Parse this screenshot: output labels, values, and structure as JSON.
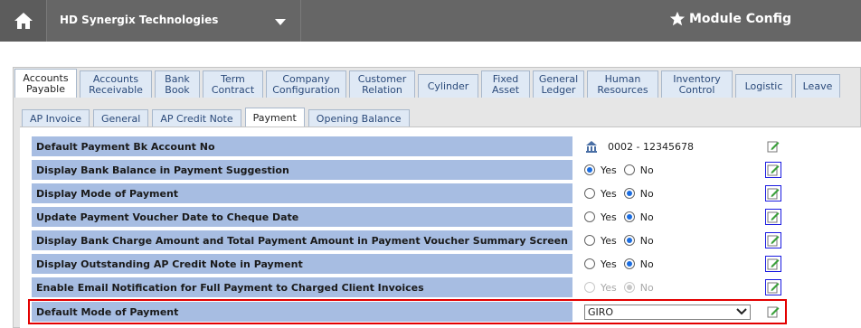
{
  "header": {
    "company": "HD Synergix Technologies",
    "module_title": "Module Config"
  },
  "main_tabs": [
    {
      "line1": "Accounts",
      "line2": "Payable",
      "active": true
    },
    {
      "line1": "Accounts",
      "line2": "Receivable"
    },
    {
      "line1": "Bank",
      "line2": "Book"
    },
    {
      "line1": "Term",
      "line2": "Contract"
    },
    {
      "line1": "Company",
      "line2": "Configuration"
    },
    {
      "line1": "Customer",
      "line2": "Relation"
    },
    {
      "line1": "Cylinder",
      "line2": ""
    },
    {
      "line1": "Fixed",
      "line2": "Asset"
    },
    {
      "line1": "General",
      "line2": "Ledger"
    },
    {
      "line1": "Human",
      "line2": "Resources"
    },
    {
      "line1": "Inventory",
      "line2": "Control"
    },
    {
      "line1": "Logistic",
      "line2": ""
    },
    {
      "line1": "Leave",
      "line2": ""
    }
  ],
  "sub_tabs": [
    {
      "label": "AP Invoice"
    },
    {
      "label": "General"
    },
    {
      "label": "AP Credit Note"
    },
    {
      "label": "Payment",
      "active": true
    },
    {
      "label": "Opening Balance"
    }
  ],
  "settings": [
    {
      "label": "Default Payment Bk Account No",
      "type": "lookup",
      "value": "0002 - 12345678"
    },
    {
      "label": "Display Bank Balance in Payment Suggestion",
      "type": "radio",
      "yes": "Yes",
      "no": "No",
      "selected": "Yes"
    },
    {
      "label": "Display Mode of Payment",
      "type": "radio",
      "yes": "Yes",
      "no": "No",
      "selected": "No"
    },
    {
      "label": "Update Payment Voucher Date to Cheque Date",
      "type": "radio",
      "yes": "Yes",
      "no": "No",
      "selected": "No"
    },
    {
      "label": "Display Bank Charge Amount and Total Payment Amount in Payment Voucher Summary Screen",
      "type": "radio",
      "yes": "Yes",
      "no": "No",
      "selected": "No"
    },
    {
      "label": "Display Outstanding AP Credit Note in Payment",
      "type": "radio",
      "yes": "Yes",
      "no": "No",
      "selected": "No"
    },
    {
      "label": "Enable Email Notification for Full Payment to Charged Client Invoices",
      "type": "radio",
      "yes": "Yes",
      "no": "No",
      "selected": "No",
      "disabled": true
    },
    {
      "label": "Default Mode of Payment",
      "type": "select",
      "value": "GIRO"
    }
  ],
  "icons": {
    "home": "home-icon",
    "caret": "chevron-down-icon",
    "star": "star-icon",
    "edit": "edit-icon",
    "lookup": "bank-lookup-icon"
  },
  "colors": {
    "topbar": "#666666",
    "label_bg": "#a7bde2",
    "highlight": "#e30000",
    "radio_selected": "#1a6ce0"
  }
}
